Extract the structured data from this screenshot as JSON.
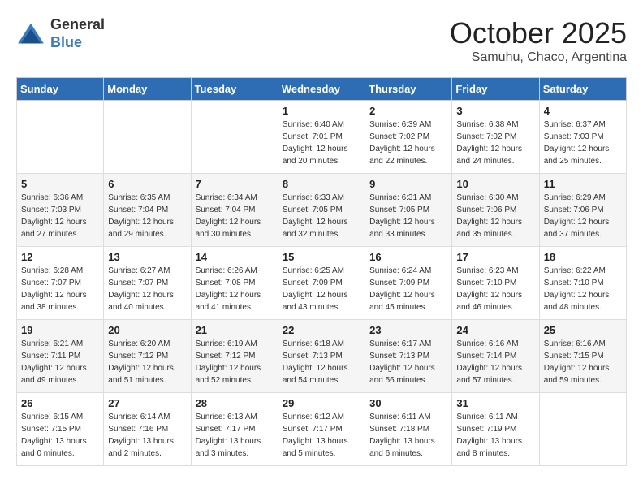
{
  "header": {
    "logo_general": "General",
    "logo_blue": "Blue",
    "month": "October 2025",
    "location": "Samuhu, Chaco, Argentina"
  },
  "weekdays": [
    "Sunday",
    "Monday",
    "Tuesday",
    "Wednesday",
    "Thursday",
    "Friday",
    "Saturday"
  ],
  "weeks": [
    [
      {
        "day": "",
        "info": ""
      },
      {
        "day": "",
        "info": ""
      },
      {
        "day": "",
        "info": ""
      },
      {
        "day": "1",
        "info": "Sunrise: 6:40 AM\nSunset: 7:01 PM\nDaylight: 12 hours\nand 20 minutes."
      },
      {
        "day": "2",
        "info": "Sunrise: 6:39 AM\nSunset: 7:02 PM\nDaylight: 12 hours\nand 22 minutes."
      },
      {
        "day": "3",
        "info": "Sunrise: 6:38 AM\nSunset: 7:02 PM\nDaylight: 12 hours\nand 24 minutes."
      },
      {
        "day": "4",
        "info": "Sunrise: 6:37 AM\nSunset: 7:03 PM\nDaylight: 12 hours\nand 25 minutes."
      }
    ],
    [
      {
        "day": "5",
        "info": "Sunrise: 6:36 AM\nSunset: 7:03 PM\nDaylight: 12 hours\nand 27 minutes."
      },
      {
        "day": "6",
        "info": "Sunrise: 6:35 AM\nSunset: 7:04 PM\nDaylight: 12 hours\nand 29 minutes."
      },
      {
        "day": "7",
        "info": "Sunrise: 6:34 AM\nSunset: 7:04 PM\nDaylight: 12 hours\nand 30 minutes."
      },
      {
        "day": "8",
        "info": "Sunrise: 6:33 AM\nSunset: 7:05 PM\nDaylight: 12 hours\nand 32 minutes."
      },
      {
        "day": "9",
        "info": "Sunrise: 6:31 AM\nSunset: 7:05 PM\nDaylight: 12 hours\nand 33 minutes."
      },
      {
        "day": "10",
        "info": "Sunrise: 6:30 AM\nSunset: 7:06 PM\nDaylight: 12 hours\nand 35 minutes."
      },
      {
        "day": "11",
        "info": "Sunrise: 6:29 AM\nSunset: 7:06 PM\nDaylight: 12 hours\nand 37 minutes."
      }
    ],
    [
      {
        "day": "12",
        "info": "Sunrise: 6:28 AM\nSunset: 7:07 PM\nDaylight: 12 hours\nand 38 minutes."
      },
      {
        "day": "13",
        "info": "Sunrise: 6:27 AM\nSunset: 7:07 PM\nDaylight: 12 hours\nand 40 minutes."
      },
      {
        "day": "14",
        "info": "Sunrise: 6:26 AM\nSunset: 7:08 PM\nDaylight: 12 hours\nand 41 minutes."
      },
      {
        "day": "15",
        "info": "Sunrise: 6:25 AM\nSunset: 7:09 PM\nDaylight: 12 hours\nand 43 minutes."
      },
      {
        "day": "16",
        "info": "Sunrise: 6:24 AM\nSunset: 7:09 PM\nDaylight: 12 hours\nand 45 minutes."
      },
      {
        "day": "17",
        "info": "Sunrise: 6:23 AM\nSunset: 7:10 PM\nDaylight: 12 hours\nand 46 minutes."
      },
      {
        "day": "18",
        "info": "Sunrise: 6:22 AM\nSunset: 7:10 PM\nDaylight: 12 hours\nand 48 minutes."
      }
    ],
    [
      {
        "day": "19",
        "info": "Sunrise: 6:21 AM\nSunset: 7:11 PM\nDaylight: 12 hours\nand 49 minutes."
      },
      {
        "day": "20",
        "info": "Sunrise: 6:20 AM\nSunset: 7:12 PM\nDaylight: 12 hours\nand 51 minutes."
      },
      {
        "day": "21",
        "info": "Sunrise: 6:19 AM\nSunset: 7:12 PM\nDaylight: 12 hours\nand 52 minutes."
      },
      {
        "day": "22",
        "info": "Sunrise: 6:18 AM\nSunset: 7:13 PM\nDaylight: 12 hours\nand 54 minutes."
      },
      {
        "day": "23",
        "info": "Sunrise: 6:17 AM\nSunset: 7:13 PM\nDaylight: 12 hours\nand 56 minutes."
      },
      {
        "day": "24",
        "info": "Sunrise: 6:16 AM\nSunset: 7:14 PM\nDaylight: 12 hours\nand 57 minutes."
      },
      {
        "day": "25",
        "info": "Sunrise: 6:16 AM\nSunset: 7:15 PM\nDaylight: 12 hours\nand 59 minutes."
      }
    ],
    [
      {
        "day": "26",
        "info": "Sunrise: 6:15 AM\nSunset: 7:15 PM\nDaylight: 13 hours\nand 0 minutes."
      },
      {
        "day": "27",
        "info": "Sunrise: 6:14 AM\nSunset: 7:16 PM\nDaylight: 13 hours\nand 2 minutes."
      },
      {
        "day": "28",
        "info": "Sunrise: 6:13 AM\nSunset: 7:17 PM\nDaylight: 13 hours\nand 3 minutes."
      },
      {
        "day": "29",
        "info": "Sunrise: 6:12 AM\nSunset: 7:17 PM\nDaylight: 13 hours\nand 5 minutes."
      },
      {
        "day": "30",
        "info": "Sunrise: 6:11 AM\nSunset: 7:18 PM\nDaylight: 13 hours\nand 6 minutes."
      },
      {
        "day": "31",
        "info": "Sunrise: 6:11 AM\nSunset: 7:19 PM\nDaylight: 13 hours\nand 8 minutes."
      },
      {
        "day": "",
        "info": ""
      }
    ]
  ]
}
